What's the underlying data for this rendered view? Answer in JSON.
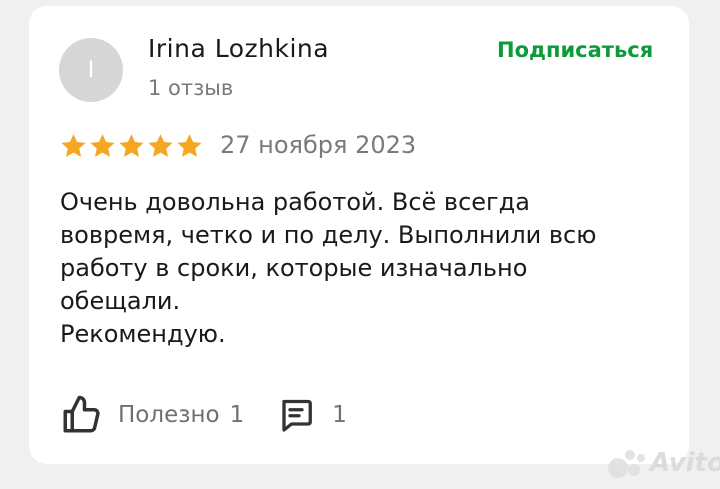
{
  "review": {
    "avatar_initial": "I",
    "author": "Irina Lozhkina",
    "reviews_count": "1 отзыв",
    "subscribe_label": "Подписаться",
    "rating": 5,
    "rating_max": 5,
    "date": "27 ноября 2023",
    "text": "Очень довольна работой. Всё всегда\nвовремя, четко и по делу. Выполнили всю\nработу в сроки, которые изначально\nобещали.\nРекомендую.",
    "useful_label": "Полезно",
    "useful_count": "1",
    "comments_count": "1"
  },
  "watermark": {
    "text": "Avito"
  },
  "colors": {
    "star": "#f5a623",
    "subscribe": "#0c9a3a",
    "avatar_bg": "#d6d6d6",
    "muted_text": "#7a7a7a"
  },
  "icons": {
    "star": "star-icon",
    "like": "thumbs-up-icon",
    "comment": "comment-icon"
  }
}
